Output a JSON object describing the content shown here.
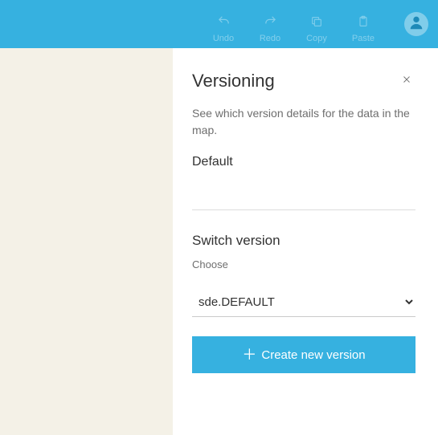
{
  "toolbar": {
    "undo_label": "Undo",
    "redo_label": "Redo",
    "copy_label": "Copy",
    "paste_label": "Paste"
  },
  "panel": {
    "title": "Versioning",
    "description": "See which version details for the data in the map.",
    "default_label": "Default",
    "switch_title": "Switch version",
    "choose_label": "Choose",
    "selected_version": "sde.DEFAULT",
    "create_button_label": "Create new version"
  },
  "colors": {
    "accent": "#36b1e0"
  }
}
